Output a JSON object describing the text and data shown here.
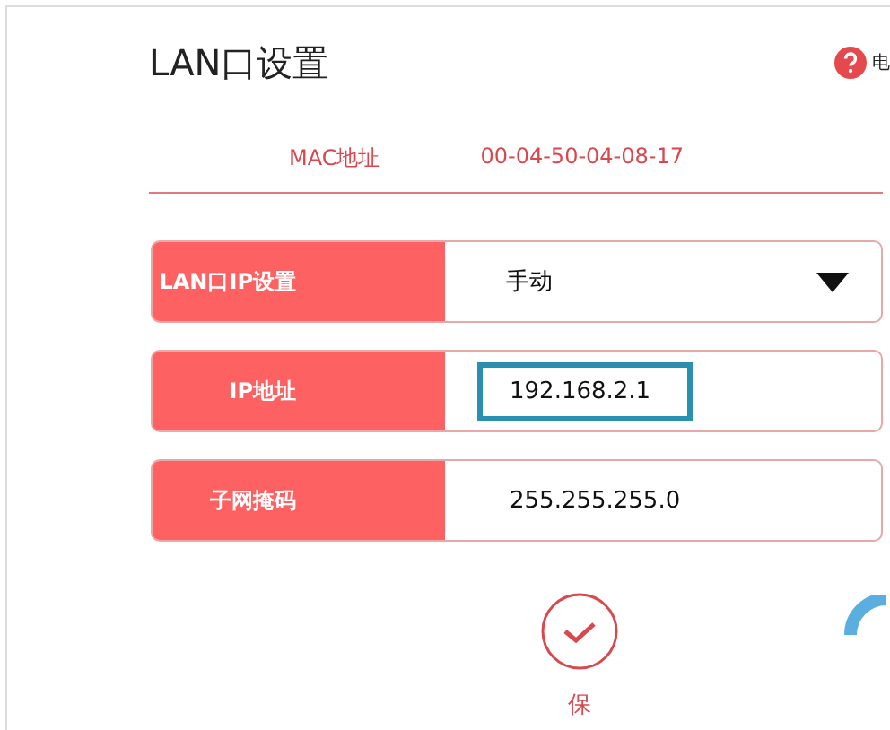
{
  "header": {
    "title": "LAN口设置",
    "help_icon_caption": "电"
  },
  "mac": {
    "label": "MAC地址",
    "value": "00-04-50-04-08-17"
  },
  "fields": [
    {
      "kind": "select",
      "label": "LAN口IP设置",
      "value": "手动"
    },
    {
      "kind": "input",
      "label": "IP地址",
      "value": "192.168.2.1",
      "focused": true
    },
    {
      "kind": "input",
      "label": "子网掩码",
      "value": "255.255.255.0"
    }
  ],
  "save": {
    "label": "保"
  }
}
